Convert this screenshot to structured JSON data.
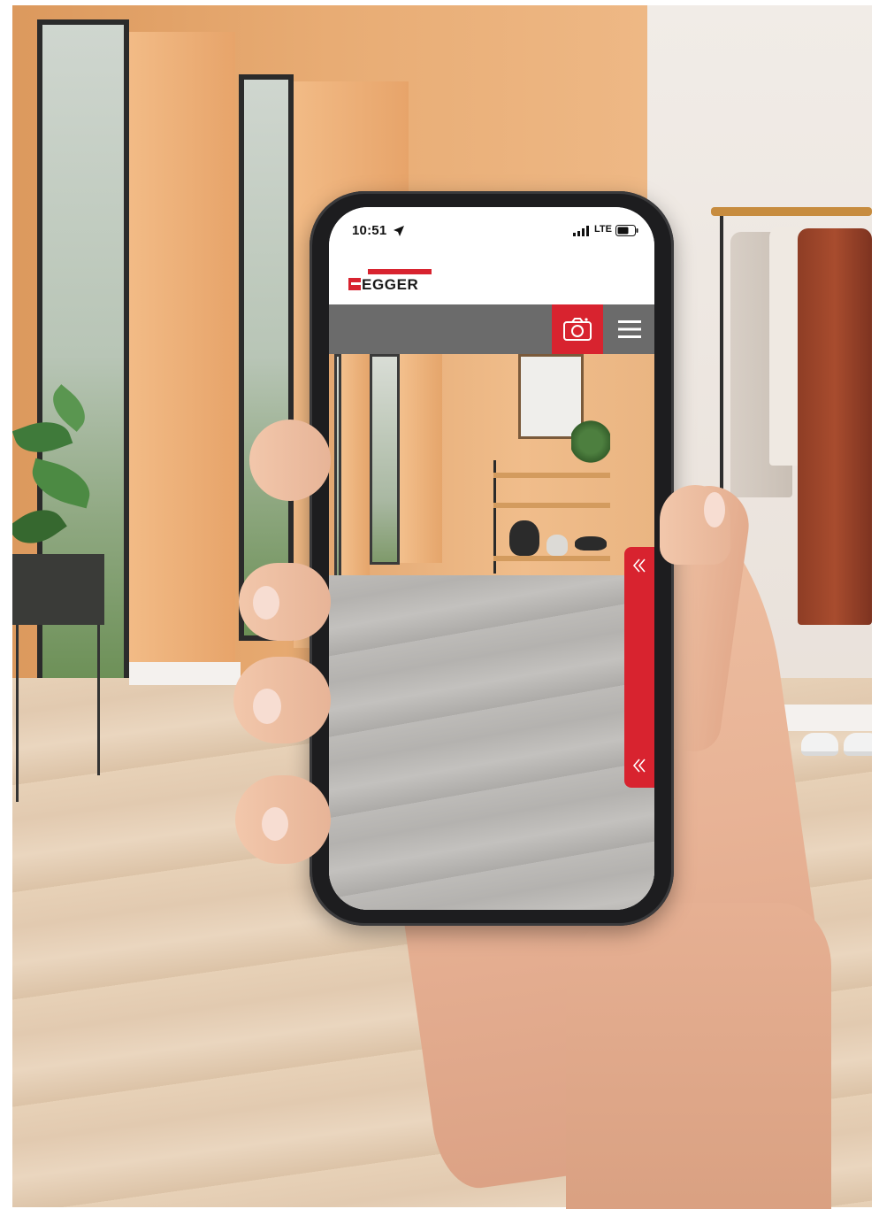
{
  "status_bar": {
    "time": "10:51",
    "network": "LTE",
    "location_icon": "location-arrow-icon",
    "signal_icon": "cellular-signal-icon",
    "battery_icon": "battery-icon"
  },
  "brand": {
    "logo_text": "EGGER",
    "accent_color": "#d8232f",
    "toolbar_color": "#6b6b6b"
  },
  "toolbar": {
    "camera_icon": "camera-icon",
    "menu_icon": "hamburger-menu-icon"
  },
  "side_panel": {
    "expand_icon": "chevron-double-left-icon"
  }
}
